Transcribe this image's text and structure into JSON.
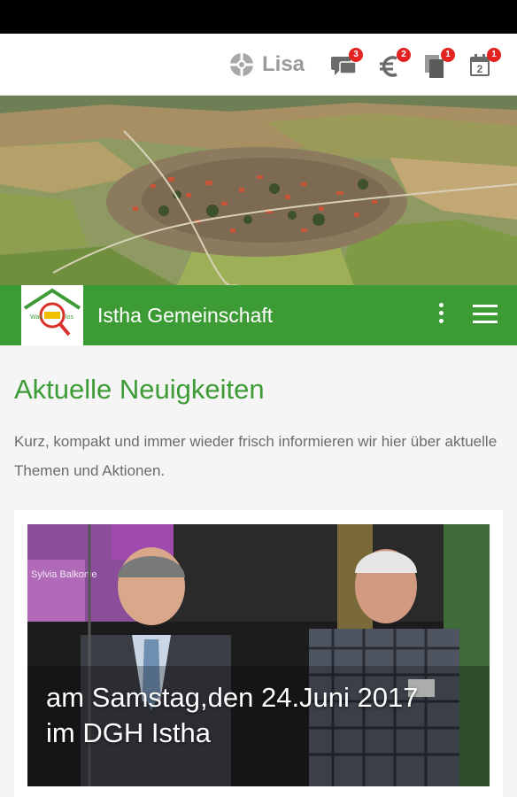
{
  "top_bar": {
    "user_name": "Lisa",
    "icons": [
      {
        "name": "chat-icon",
        "badge": "3"
      },
      {
        "name": "euro-icon",
        "badge": "2"
      },
      {
        "name": "documents-icon",
        "badge": "1"
      },
      {
        "name": "calendar-icon",
        "badge": "1",
        "day": "2"
      }
    ]
  },
  "app_bar": {
    "title": "Istha Gemeinschaft",
    "logo_text": "Was Istha los"
  },
  "news": {
    "heading": "Aktuelle Neuigkeiten",
    "intro": "Kurz, kompakt und immer wieder frisch informieren wir hier über aktuelle Themen und Aktionen.",
    "items": [
      {
        "caption": "am Samstag,den 24.Juni 2017 im DGH Istha",
        "banner_text": "Sylvia Balkonie"
      }
    ]
  },
  "colors": {
    "brand_green": "#3d9b35",
    "badge_red": "#e32222",
    "status_bar": "#000000"
  }
}
